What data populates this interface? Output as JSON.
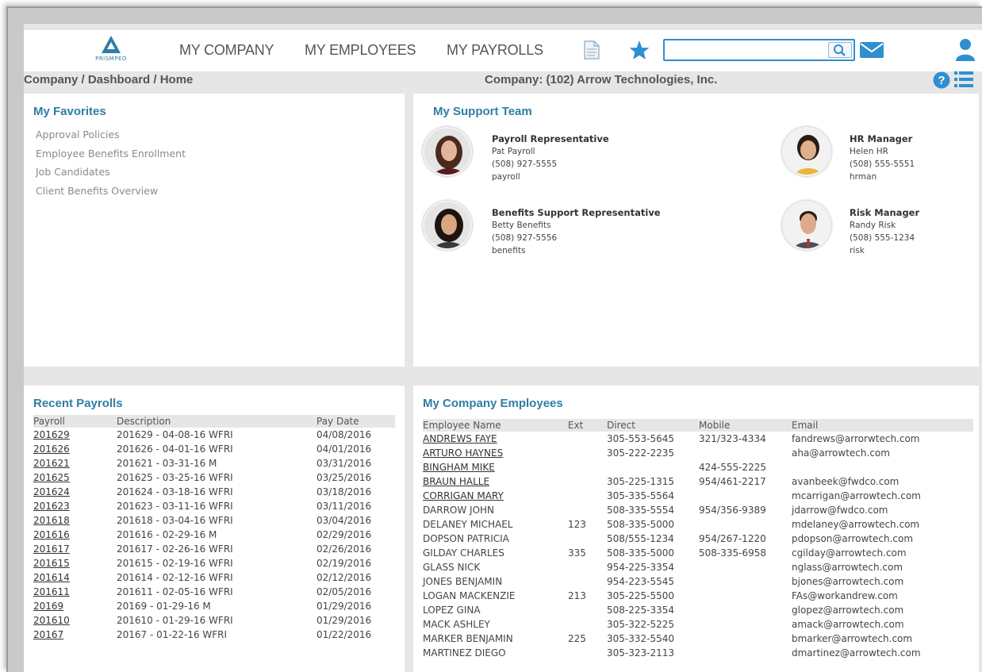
{
  "nav": {
    "logo_text": "PRISMPEO",
    "links": [
      "MY COMPANY",
      "MY EMPLOYEES",
      "MY PAYROLLS"
    ],
    "search_value": "",
    "colors": {
      "accent": "#2e7ea6",
      "icon_blue": "#2f8fd0"
    }
  },
  "breadcrumb": "Company / Dashboard / Home",
  "company": "Company: (102) Arrow Technologies, Inc.",
  "favorites": {
    "title": "My Favorites",
    "items": [
      "Approval Policies",
      "Employee Benefits Enrollment",
      "Job Candidates",
      "Client Benefits Overview"
    ]
  },
  "support": {
    "title": "My Support Team",
    "members": [
      {
        "role": "Payroll Representative",
        "name": "Pat Payroll",
        "phone": "(508) 927-5555",
        "user": "payroll"
      },
      {
        "role": "HR Manager",
        "name": "Helen HR",
        "phone": "(508) 555-5551",
        "user": "hrman"
      },
      {
        "role": "Benefits Support Representative",
        "name": "Betty Benefits",
        "phone": "(508) 927-5556",
        "user": "benefits"
      },
      {
        "role": "Risk Manager",
        "name": "Randy Risk",
        "phone": "(508) 555-1234",
        "user": "risk"
      }
    ]
  },
  "payrolls": {
    "title": "Recent Payrolls",
    "headers": [
      "Payroll",
      "Description",
      "Pay Date"
    ],
    "rows": [
      [
        "201629",
        "201629 - 04-08-16 WFRI",
        "04/08/2016"
      ],
      [
        "201626",
        "201626 - 04-01-16 WFRI",
        "04/01/2016"
      ],
      [
        "201621",
        "201621 - 03-31-16 M",
        "03/31/2016"
      ],
      [
        "201625",
        "201625 - 03-25-16 WFRI",
        "03/25/2016"
      ],
      [
        "201624",
        "201624 - 03-18-16 WFRI",
        "03/18/2016"
      ],
      [
        "201623",
        "201623 - 03-11-16 WFRI",
        "03/11/2016"
      ],
      [
        "201618",
        "201618 - 03-04-16 WFRI",
        "03/04/2016"
      ],
      [
        "201616",
        "201616 - 02-29-16 M",
        "02/29/2016"
      ],
      [
        "201617",
        "201617 - 02-26-16 WFRI",
        "02/26/2016"
      ],
      [
        "201615",
        "201615 - 02-19-16 WFRI",
        "02/19/2016"
      ],
      [
        "201614",
        "201614 - 02-12-16 WFRI",
        "02/12/2016"
      ],
      [
        "201611",
        "201611 - 02-05-16 WFRI",
        "02/05/2016"
      ],
      [
        "20169",
        "20169 - 01-29-16 M",
        "01/29/2016"
      ],
      [
        "201610",
        "201610 - 01-29-16 WFRI",
        "01/29/2016"
      ],
      [
        "20167",
        "20167 - 01-22-16 WFRI",
        "01/22/2016"
      ]
    ]
  },
  "employees": {
    "title": "My Company Employees",
    "headers": [
      "Employee Name",
      "Ext",
      "Direct",
      "Mobile",
      "Email"
    ],
    "rows": [
      [
        "ANDREWS FAYE",
        "",
        "305-553-5645",
        "321/323-4334",
        "fandrews@arrorwtech.com"
      ],
      [
        "ARTURO HAYNES",
        "",
        "305-222-2235",
        "",
        "aha@arrowtech.com"
      ],
      [
        "BINGHAM MIKE",
        "",
        "",
        "424-555-2225",
        ""
      ],
      [
        "BRAUN HALLE",
        "",
        "305-225-1315",
        "954/461-2217",
        "avanbeek@fwdco.com"
      ],
      [
        "CORRIGAN MARY",
        "",
        "305-335-5564",
        "",
        "mcarrigan@arrowtech.com"
      ],
      [
        "DARROW JOHN",
        "",
        "508-335-5554",
        "954/356-9389",
        "jdarrow@fwdco.com"
      ],
      [
        "DELANEY MICHAEL",
        "123",
        "508-335-5000",
        "",
        "mdelaney@arrowtech.com"
      ],
      [
        "DOPSON PATRICIA",
        "",
        "508/555-1234",
        "954/267-1220",
        "pdopson@arrowtech.com"
      ],
      [
        "GILDAY CHARLES",
        "335",
        "508-335-5000",
        "508-335-6958",
        "cgilday@arrowtech.com"
      ],
      [
        "GLASS NICK",
        "",
        "954-225-3354",
        "",
        "nglass@arrowtech.com"
      ],
      [
        "JONES BENJAMIN",
        "",
        "954-223-5545",
        "",
        "bjones@arrowtech.com"
      ],
      [
        "LOGAN MACKENZIE",
        "213",
        "305-225-5500",
        "",
        "FAs@workandrew.com"
      ],
      [
        "LOPEZ GINA",
        "",
        "508-225-3354",
        "",
        "glopez@arrowtech.com"
      ],
      [
        "MACK ASHLEY",
        "",
        "305-322-5225",
        "",
        "amack@arrowtech.com"
      ],
      [
        "MARKER BENJAMIN",
        "225",
        "305-332-5540",
        "",
        "bmarker@arrowtech.com"
      ],
      [
        "MARTINEZ DIEGO",
        "",
        "305-323-2113",
        "",
        "dmartinez@arrowtech.com"
      ]
    ]
  }
}
